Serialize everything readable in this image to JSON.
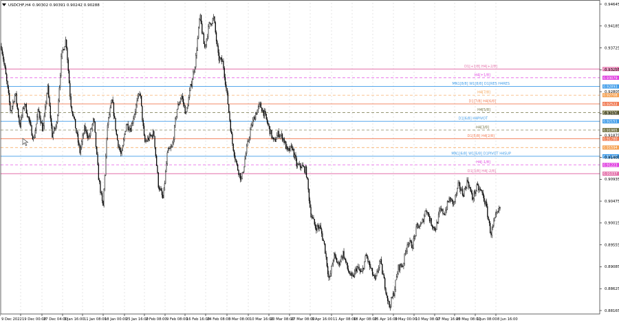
{
  "header": {
    "symbol_timeframe": "USDCHF,H4",
    "ohlc": "0.90302 0.90391 0.90242 0.90288"
  },
  "colors": {
    "candle": "#000000",
    "grid": "#c8c8c8",
    "pink": "#e36fa8",
    "magenta": "#e040e0",
    "blue": "#3d9be9",
    "orange": "#f5a050",
    "salmon": "#f07850",
    "olive": "#707040",
    "gray": "#a0a0a0"
  },
  "chart_data": {
    "type": "candlestick",
    "ylim": [
      0.88125,
      0.94645
    ],
    "y_ticks": [
      "0.94645",
      "0.94185",
      "0.93725",
      "0.93255",
      "0.92805",
      "0.92335",
      "0.91875",
      "0.91405",
      "0.90935",
      "0.90475",
      "0.90015",
      "0.89555",
      "0.89085",
      "0.88625",
      "0.88165"
    ],
    "x_ticks": [
      "9 Dec 2022",
      "19 Dec 00:00",
      "27 Dec 04:00",
      "3 Jan 16:00",
      "11 Jan 08:00",
      "18 Jan 00:00",
      "25 Jan 16:00",
      "2 Feb 08:00",
      "9 Feb 08:00",
      "16 Feb 16:00",
      "24 Feb 08:00",
      "3 Mar 08:00",
      "10 Mar 16:00",
      "20 Mar 08:00",
      "27 Mar 08:00",
      "3 Apr 16:00",
      "11 Apr 08:00",
      "18 Apr 08:00",
      "25 Apr 16:00",
      "3 May 00:00",
      "10 May 08:00",
      "17 May 16:00",
      "25 May 08:00",
      "1 Jun 08:00",
      "8 Jun 16:00"
    ],
    "close_path": [
      0.9375,
      0.931,
      0.9235,
      0.9275,
      0.9205,
      0.9255,
      0.9215,
      0.9175,
      0.924,
      0.9195,
      0.929,
      0.9185,
      0.921,
      0.9355,
      0.939,
      0.9255,
      0.9205,
      0.915,
      0.92,
      0.918,
      0.922,
      0.91,
      0.903,
      0.921,
      0.926,
      0.918,
      0.914,
      0.921,
      0.92,
      0.924,
      0.928,
      0.917,
      0.918,
      0.919,
      0.908,
      0.905,
      0.915,
      0.916,
      0.924,
      0.927,
      0.923,
      0.929,
      0.934,
      0.944,
      0.937,
      0.942,
      0.9435,
      0.935,
      0.934,
      0.926,
      0.917,
      0.912,
      0.909,
      0.915,
      0.92,
      0.923,
      0.925,
      0.923,
      0.92,
      0.917,
      0.919,
      0.918,
      0.915,
      0.916,
      0.912,
      0.912,
      0.911,
      0.902,
      0.899,
      0.899,
      0.895,
      0.8875,
      0.893,
      0.891,
      0.8935,
      0.89,
      0.888,
      0.8905,
      0.889,
      0.893,
      0.89,
      0.8875,
      0.892,
      0.887,
      0.882,
      0.885,
      0.8905,
      0.891,
      0.896,
      0.895,
      0.899,
      0.8995,
      0.903,
      0.9,
      0.8985,
      0.9025,
      0.902,
      0.905,
      0.904,
      0.908,
      0.906,
      0.909,
      0.905,
      0.9075,
      0.9065,
      0.9035,
      0.8975,
      0.901,
      0.903
    ],
    "levels": [
      {
        "label": "D1[+1/8] H4[+2/8]",
        "value": 0.93264,
        "price": "0.93264",
        "color": "pink",
        "dash": false
      },
      {
        "label": "H4[+1/8]",
        "value": 0.93079,
        "price": "0.93079",
        "color": "magenta",
        "dash": true
      },
      {
        "label": "MN1[8/8] W1[8/8] D1[RES H4RES",
        "value": 0.92893,
        "price": "0.92893",
        "color": "blue",
        "dash": false
      },
      {
        "label": "H4[7/8]",
        "value": 0.92708,
        "price": "0.92708",
        "color": "orange",
        "dash": true
      },
      {
        "label": "D1[7/8] H4[6/8]",
        "value": 0.92522,
        "price": "0.92522",
        "color": "salmon",
        "dash": false
      },
      {
        "label": "H4[5/8]",
        "value": 0.92336,
        "price": "0.92336",
        "color": "olive",
        "dash": true
      },
      {
        "label": "D1[6/8] H4PIVOT",
        "value": 0.92151,
        "price": "0.92151",
        "color": "blue",
        "dash": false
      },
      {
        "label": "H4[3/8]",
        "value": 0.91965,
        "price": "0.91965",
        "color": "olive",
        "dash": true
      },
      {
        "label": "D1[5/8] H4[2/8]",
        "value": 0.9178,
        "price": "0.91780",
        "color": "salmon",
        "dash": false
      },
      {
        "label": "",
        "value": 0.91594,
        "price": "0.91594",
        "color": "orange",
        "dash": true
      },
      {
        "label": "MN1[6/8] W1[6/8] D1PIVOT H4SUP",
        "value": 0.91408,
        "price": "0.91408",
        "color": "blue",
        "dash": false
      },
      {
        "label": "H4[-1/8]",
        "value": 0.91223,
        "price": "0.91223",
        "color": "magenta",
        "dash": true
      },
      {
        "label": "D1[3/8] H4[-2/8]",
        "value": 0.91037,
        "price": "0.91037",
        "color": "pink",
        "dash": false
      }
    ],
    "current_price": "0.90288",
    "grid": true
  }
}
